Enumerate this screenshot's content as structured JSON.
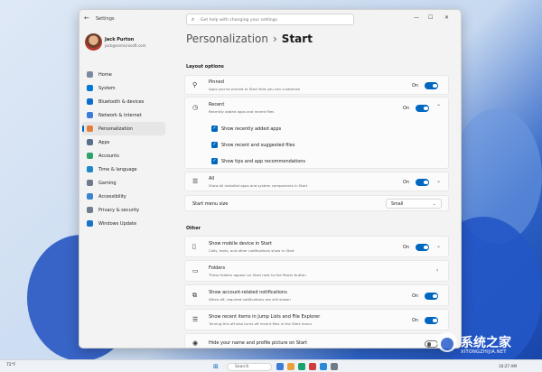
{
  "window": {
    "title": "Settings",
    "search_placeholder": "Get help with changing your settings",
    "controls": [
      "—",
      "☐",
      "✕"
    ]
  },
  "user": {
    "name": "Jack Purton",
    "email": "jack@onmicrosoft.com"
  },
  "sidebar": {
    "items": [
      {
        "label": "Home",
        "icon": "home-icon",
        "color": "#7a8aa0"
      },
      {
        "label": "System",
        "icon": "system-icon",
        "color": "#0078d4"
      },
      {
        "label": "Bluetooth & devices",
        "icon": "bluetooth-icon",
        "color": "#0a6ed1"
      },
      {
        "label": "Network & internet",
        "icon": "network-icon",
        "color": "#3b7dd8"
      },
      {
        "label": "Personalization",
        "icon": "brush-icon",
        "color": "#e4803a",
        "active": true
      },
      {
        "label": "Apps",
        "icon": "apps-icon",
        "color": "#5a6f8c"
      },
      {
        "label": "Accounts",
        "icon": "accounts-icon",
        "color": "#2ea36b"
      },
      {
        "label": "Time & language",
        "icon": "time-icon",
        "color": "#1e88c8"
      },
      {
        "label": "Gaming",
        "icon": "gaming-icon",
        "color": "#6d7b8c"
      },
      {
        "label": "Accessibility",
        "icon": "accessibility-icon",
        "color": "#3a84d0"
      },
      {
        "label": "Privacy & security",
        "icon": "shield-icon",
        "color": "#6f7d8e"
      },
      {
        "label": "Windows Update",
        "icon": "update-icon",
        "color": "#1a73c9"
      }
    ]
  },
  "breadcrumb": {
    "parent": "Personalization",
    "sep": "›",
    "current": "Start"
  },
  "layout_section": "Layout options",
  "pinned": {
    "title": "Pinned",
    "sub": "Apps you've pinned to Start that you can customize",
    "state": "On"
  },
  "recent": {
    "title": "Recent",
    "sub": "Recently added apps and recent files",
    "state": "On",
    "options": [
      "Show recently added apps",
      "Show recent and suggested files",
      "Show tips and app recommendations"
    ]
  },
  "all": {
    "title": "All",
    "sub": "Show all installed apps and system components in Start",
    "state": "On"
  },
  "menu_size": {
    "label": "Start menu size",
    "value": "Small"
  },
  "other_section": "Other",
  "other": [
    {
      "title": "Show mobile device in Start",
      "sub": "Calls, texts, and other notifications show in Start",
      "state": "On"
    },
    {
      "title": "Folders",
      "sub": "These folders appear on Start next to the Power button",
      "state": ""
    },
    {
      "title": "Show account-related notifications",
      "sub": "When off, required notifications are still shown",
      "state": "On"
    },
    {
      "title": "Show recent items in Jump Lists and File Explorer",
      "sub": "Turning this off also turns off recent files in the Start menu",
      "state": "On"
    },
    {
      "title": "Hide your name and profile picture on Start",
      "sub": "",
      "state": ""
    }
  ],
  "taskbar": {
    "weather": "72°F",
    "search": "Search",
    "time": "10:27 AM"
  },
  "watermark": {
    "text": "系统之家",
    "url": "XITONGZHIJIA.NET"
  },
  "colors": {
    "accent": "#0067c0"
  }
}
